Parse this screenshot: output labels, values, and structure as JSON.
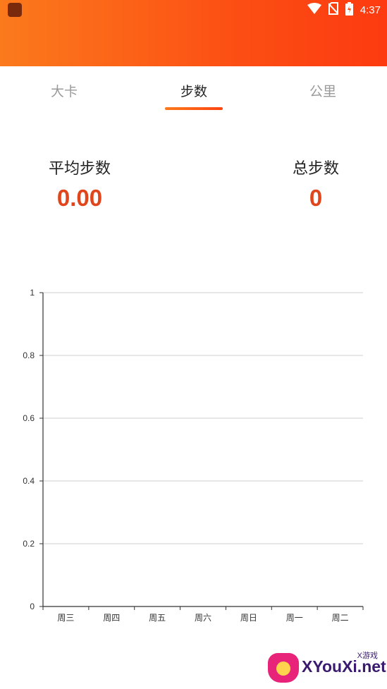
{
  "status_bar": {
    "time": "4:37",
    "icons": [
      "wifi-icon",
      "no-sim-icon",
      "battery-charging-icon"
    ]
  },
  "tabs": [
    {
      "label": "大卡",
      "active": false
    },
    {
      "label": "步数",
      "active": true
    },
    {
      "label": "公里",
      "active": false
    }
  ],
  "stats": {
    "average_label": "平均步数",
    "average_value": "0.00",
    "total_label": "总步数",
    "total_value": "0"
  },
  "colors": {
    "header_gradient_start": "#fb7a1c",
    "header_gradient_end": "#fd3a10",
    "value_red": "#e0451b",
    "tab_active": "#222222",
    "tab_inactive": "#9a9a9a"
  },
  "chart_data": {
    "type": "bar",
    "categories": [
      "周三",
      "周四",
      "周五",
      "周六",
      "周日",
      "周一",
      "周二"
    ],
    "values": [
      0,
      0,
      0,
      0,
      0,
      0,
      0
    ],
    "yticks": [
      "0",
      "0.2",
      "0.4",
      "0.6",
      "0.8",
      "1"
    ],
    "ylim": [
      0,
      1
    ],
    "grid": true
  },
  "watermark": {
    "text": "XYouXi.net",
    "small_text": "X游戏"
  }
}
